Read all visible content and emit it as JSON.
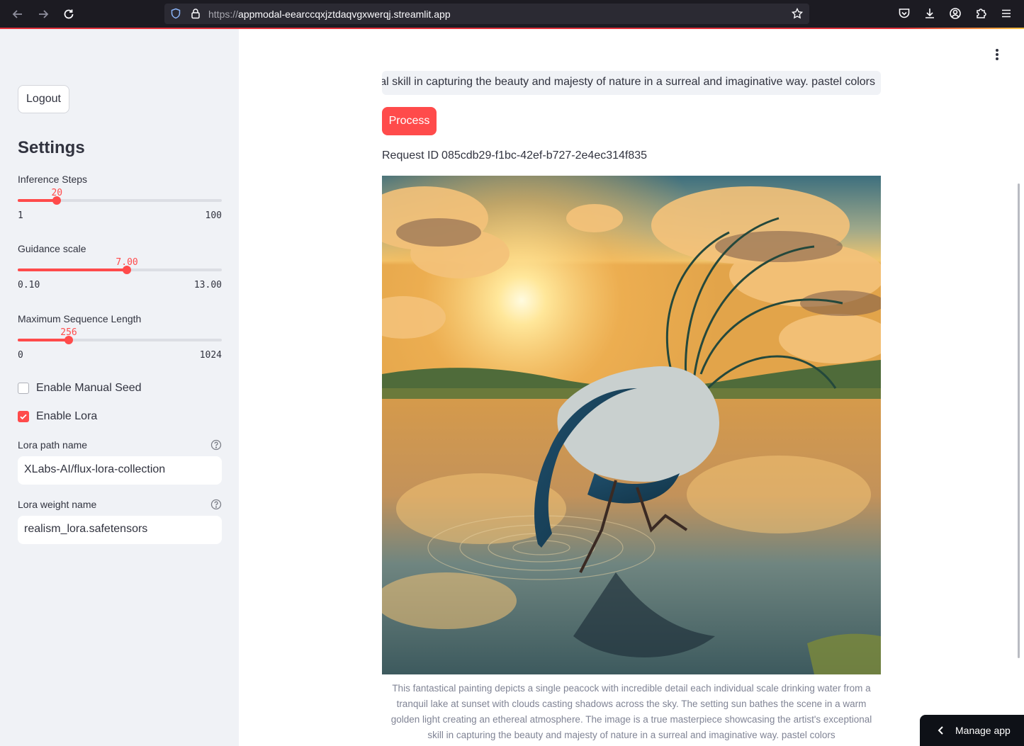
{
  "browser": {
    "url_prefix": "https://",
    "url_host": "appmodal-eearccqxjztdaqvgxwerqj.streamlit.app"
  },
  "sidebar": {
    "logout_label": "Logout",
    "settings_title": "Settings",
    "sliders": [
      {
        "label": "Inference Steps",
        "value": "20",
        "min": "1",
        "max": "100",
        "fraction": 0.192
      },
      {
        "label": "Guidance scale",
        "value": "7.00",
        "min": "0.10",
        "max": "13.00",
        "fraction": 0.535
      },
      {
        "label": "Maximum Sequence Length",
        "value": "256",
        "min": "0",
        "max": "1024",
        "fraction": 0.25
      }
    ],
    "checkboxes": [
      {
        "label": "Enable Manual Seed",
        "checked": false
      },
      {
        "label": "Enable Lora",
        "checked": true
      }
    ],
    "lora_path": {
      "label": "Lora path name",
      "value": "XLabs-AI/flux-lora-collection"
    },
    "lora_weight": {
      "label": "Lora weight name",
      "value": "realism_lora.safetensors"
    }
  },
  "main": {
    "prompt_visible_text": "otional skill in capturing the beauty and majesty of nature in a surreal and imaginative way. pastel colors",
    "process_label": "Process",
    "request_id_label": "Request ID",
    "request_id_value": "085cdb29-f1bc-42ef-b727-2e4ec314f835",
    "caption": "This fantastical painting depicts a single peacock with incredible detail each individual scale drinking water from a tranquil lake at sunset with clouds casting shadows across the sky. The setting sun bathes the scene in a warm golden light creating an ethereal atmosphere. The image is a true masterpiece showcasing the artist's exceptional skill in capturing the beauty and majesty of nature in a surreal and imaginative way. pastel colors"
  },
  "manage_app_label": "Manage app",
  "colors": {
    "accent": "#ff4b4b",
    "sidebar_bg": "#f0f2f6",
    "text": "#31333f"
  }
}
